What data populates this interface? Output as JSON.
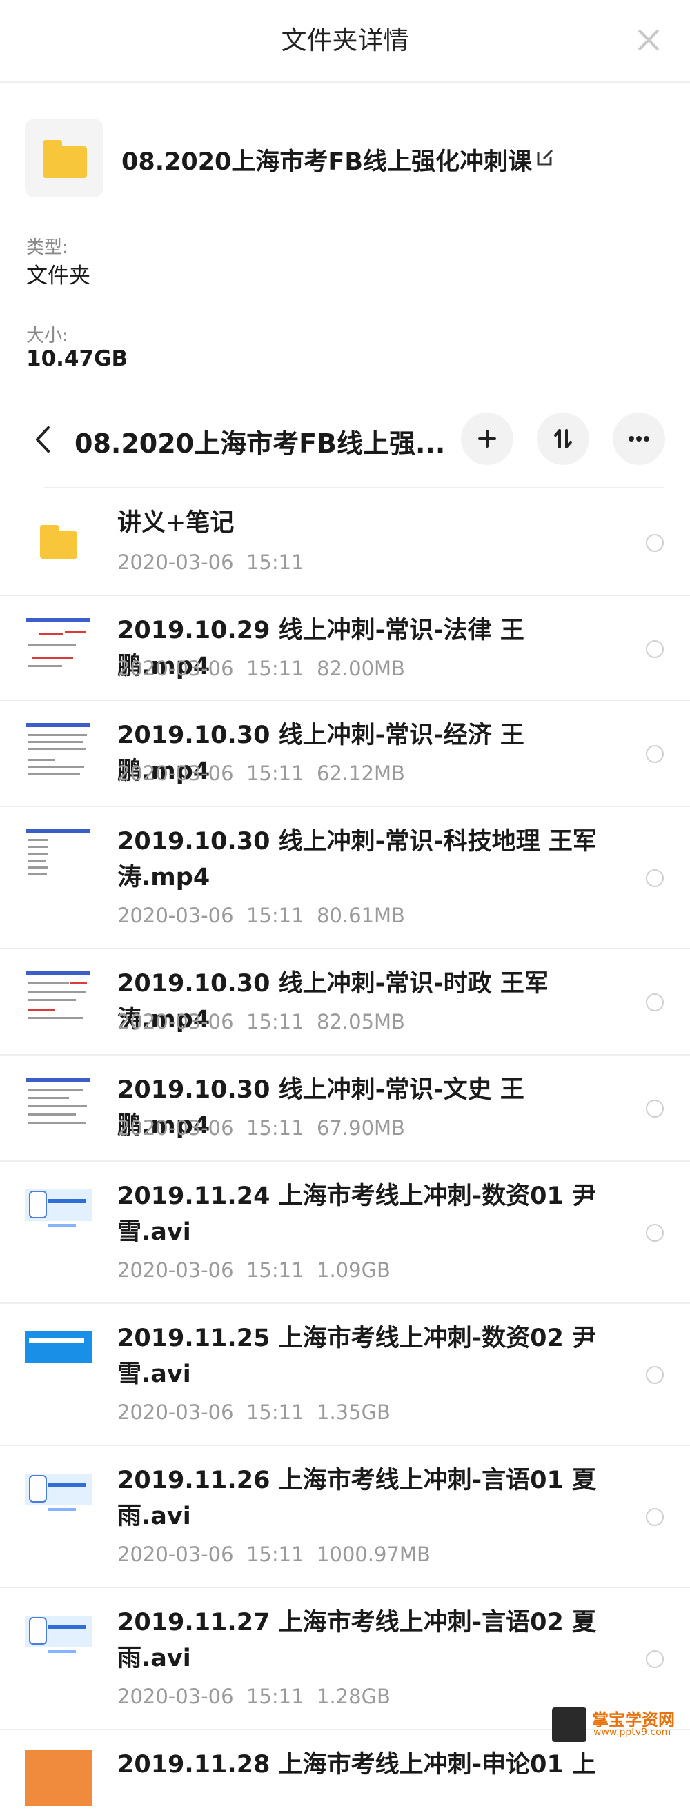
{
  "header": {
    "title": "文件夹详情"
  },
  "folder": {
    "name": "08.2020上海市考FB线上强化冲刺课",
    "type_label": "类型:",
    "type_value": "文件夹",
    "size_label": "大小:",
    "size_value": "10.47GB"
  },
  "breadcrumb": {
    "title": "08.2020上海市考FB线上强..."
  },
  "files": [
    {
      "name": "讲义+笔记",
      "date": "2020-03-06",
      "time": "15:11",
      "size": ""
    },
    {
      "name": "2019.10.29 线上冲刺-常识-法律 王鹏.mp4",
      "date": "2020-03-06",
      "time": "15:11",
      "size": "82.00MB"
    },
    {
      "name": "2019.10.30 线上冲刺-常识-经济 王鹏.mp4",
      "date": "2020-03-06",
      "time": "15:11",
      "size": "62.12MB"
    },
    {
      "name": "2019.10.30 线上冲刺-常识-科技地理 王军涛.mp4",
      "date": "2020-03-06",
      "time": "15:11",
      "size": "80.61MB"
    },
    {
      "name": "2019.10.30 线上冲刺-常识-时政 王军涛.mp4",
      "date": "2020-03-06",
      "time": "15:11",
      "size": "82.05MB"
    },
    {
      "name": "2019.10.30 线上冲刺-常识-文史 王鹏.mp4",
      "date": "2020-03-06",
      "time": "15:11",
      "size": "67.90MB"
    },
    {
      "name": "2019.11.24 上海市考线上冲刺-数资01 尹雪.avi",
      "date": "2020-03-06",
      "time": "15:11",
      "size": "1.09GB"
    },
    {
      "name": "2019.11.25 上海市考线上冲刺-数资02 尹雪.avi",
      "date": "2020-03-06",
      "time": "15:11",
      "size": "1.35GB"
    },
    {
      "name": "2019.11.26 上海市考线上冲刺-言语01 夏雨.avi",
      "date": "2020-03-06",
      "time": "15:11",
      "size": "1000.97MB"
    },
    {
      "name": "2019.11.27 上海市考线上冲刺-言语02 夏雨.avi",
      "date": "2020-03-06",
      "time": "15:11",
      "size": "1.28GB"
    },
    {
      "name": "2019.11.28 上海市考线上冲刺-申论01 上",
      "date": "",
      "time": "",
      "size": ""
    }
  ],
  "watermark": {
    "text": "掌宝学资网",
    "url": "www.pptv9.com"
  }
}
